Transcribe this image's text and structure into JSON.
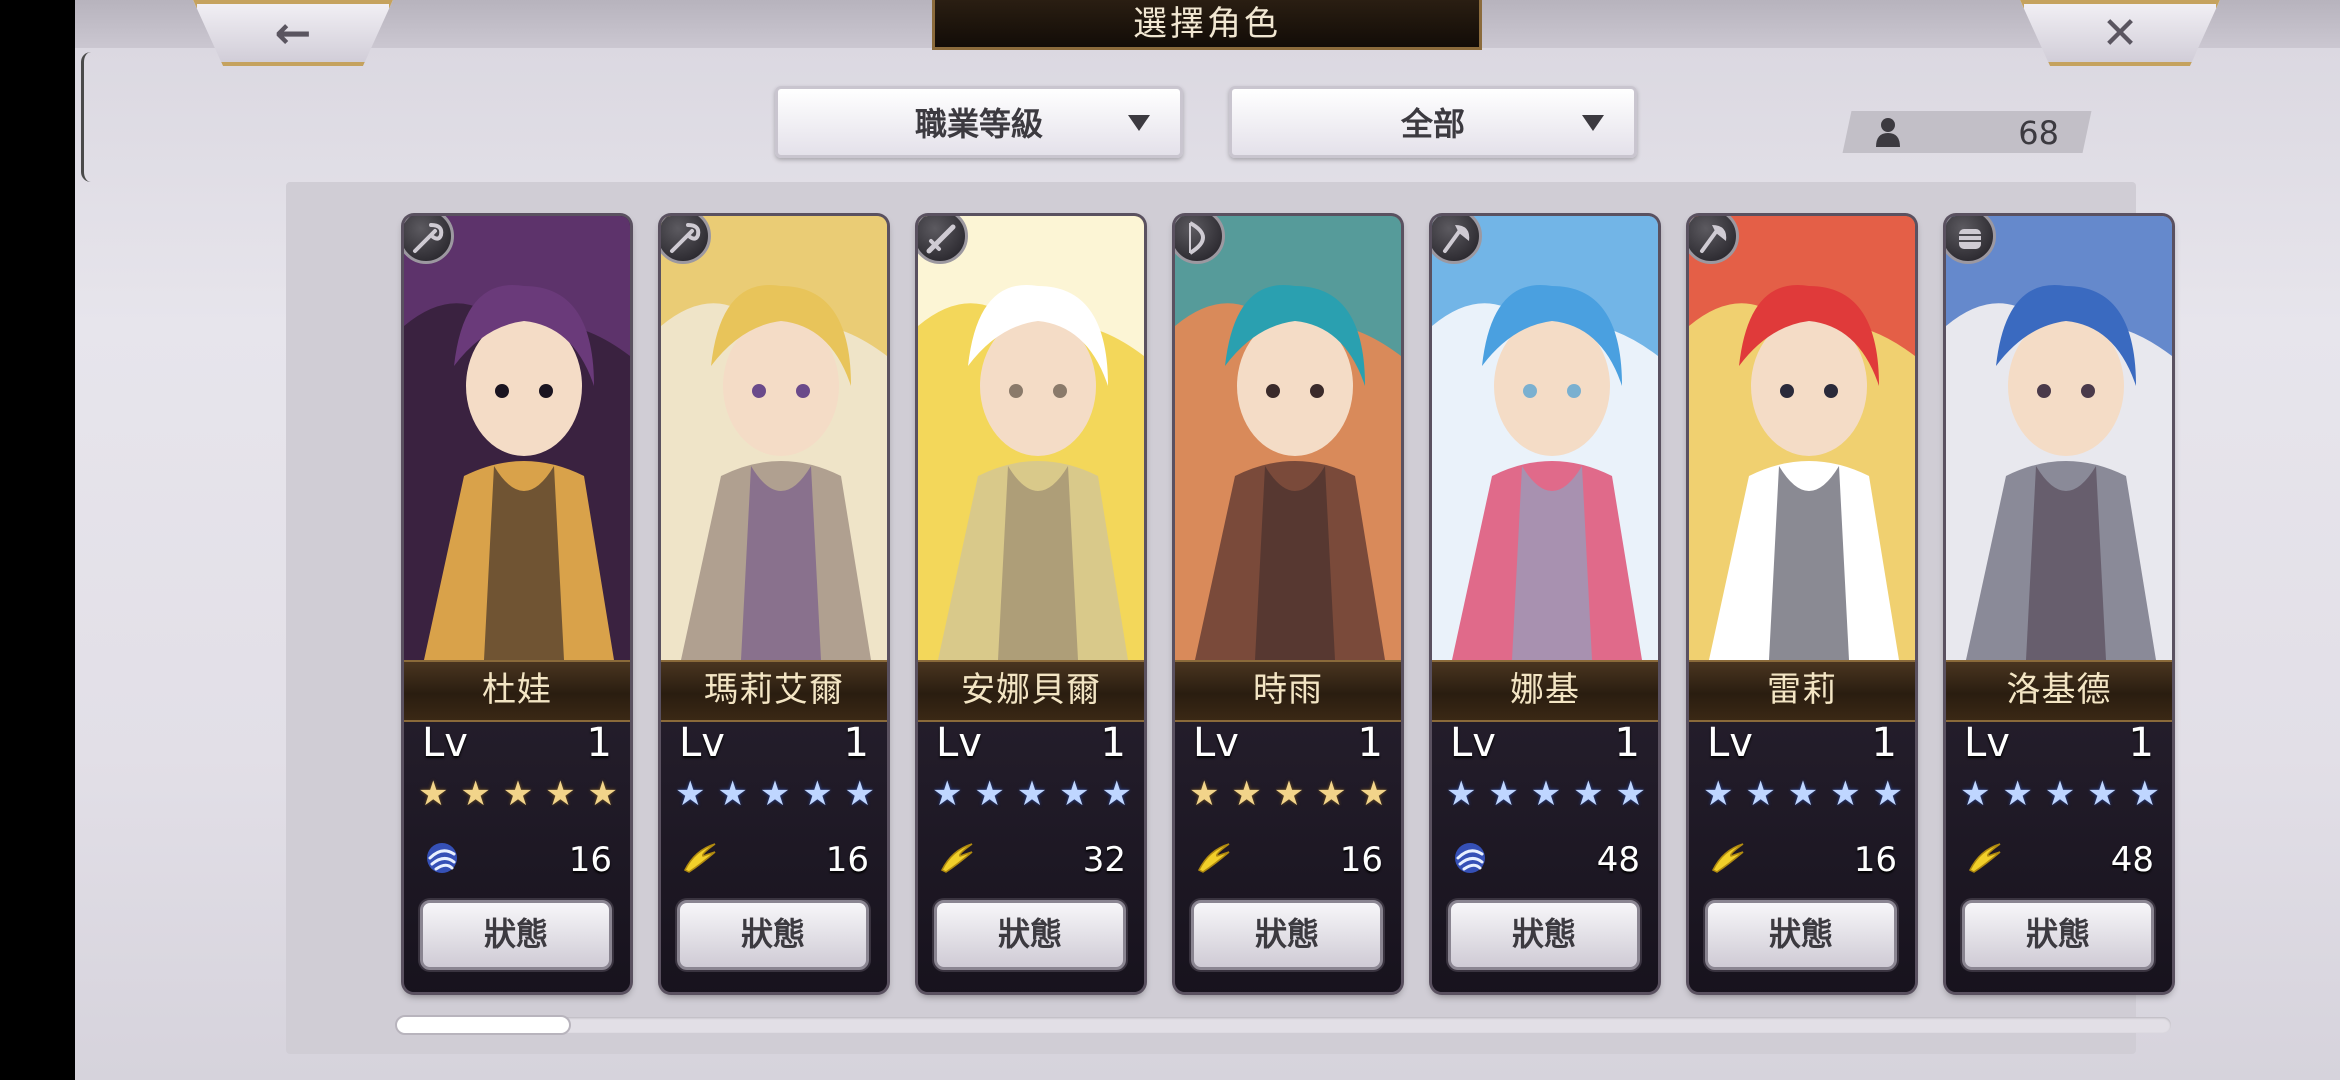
{
  "header": {
    "title": "選擇角色",
    "back_icon": "←",
    "close_icon": "✕"
  },
  "filters": {
    "job_sort": "職業等級",
    "category": "全部"
  },
  "roster": {
    "count": "68"
  },
  "lv_label": "Lv",
  "status_label": "狀態",
  "characters": [
    {
      "name": "杜娃",
      "level": "1",
      "stars": "★★★★★",
      "star_color": "gold",
      "element": "wind",
      "cost": "16",
      "class": "staff",
      "palette": [
        "#3a2240",
        "#6a3a7a",
        "#d9a24a",
        "#1a1420"
      ]
    },
    {
      "name": "瑪莉艾爾",
      "level": "1",
      "stars": "★★★★★",
      "star_color": "blue",
      "element": "lightning",
      "cost": "16",
      "class": "staff",
      "palette": [
        "#efe4c8",
        "#e8c45a",
        "#b0a090",
        "#6a4a8a"
      ]
    },
    {
      "name": "安娜貝爾",
      "level": "1",
      "stars": "★★★★★",
      "star_color": "blue",
      "element": "lightning",
      "cost": "32",
      "class": "sword",
      "palette": [
        "#f3d75a",
        "#ffffff",
        "#d9c98a",
        "#8a7a6a"
      ]
    },
    {
      "name": "時雨",
      "level": "1",
      "stars": "★★★★★",
      "star_color": "gold",
      "element": "lightning",
      "cost": "16",
      "class": "bow",
      "palette": [
        "#d98a5a",
        "#2aa0b0",
        "#7a4a3a",
        "#3a2a2a"
      ]
    },
    {
      "name": "娜基",
      "level": "1",
      "stars": "★★★★★",
      "star_color": "blue",
      "element": "wind",
      "cost": "48",
      "class": "axe",
      "palette": [
        "#eaf2fa",
        "#4aa0e0",
        "#e06a8a",
        "#7ab0d0"
      ]
    },
    {
      "name": "雷莉",
      "level": "1",
      "stars": "★★★★★",
      "star_color": "blue",
      "element": "lightning",
      "cost": "16",
      "class": "axe",
      "palette": [
        "#f0d070",
        "#e03a3a",
        "#ffffff",
        "#2a2a3a"
      ]
    },
    {
      "name": "洛基德",
      "level": "1",
      "stars": "★★★★★",
      "star_color": "blue",
      "element": "lightning",
      "cost": "48",
      "class": "fist",
      "palette": [
        "#e8e8ee",
        "#3a6ac0",
        "#8a8a98",
        "#4a3a4a"
      ]
    }
  ],
  "colors": {
    "gold_star": "#f2d48a",
    "blue_star": "#bfd6ff",
    "name_text": "#f3e5c4"
  }
}
